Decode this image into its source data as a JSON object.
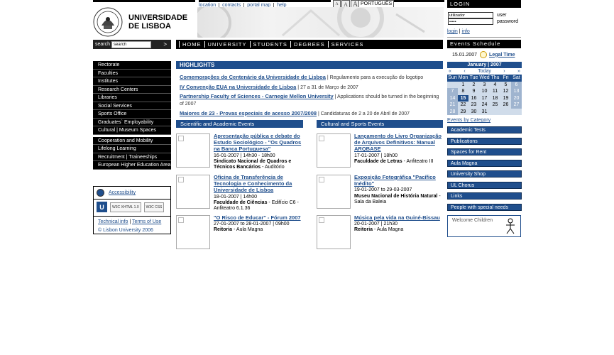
{
  "top": {
    "links": [
      "location",
      "contacts",
      "portal map",
      "help"
    ],
    "font_buttons": [
      "A",
      "A",
      "A"
    ],
    "language": "PORTUGUÊS"
  },
  "logo": {
    "line1": "UNIVERSIDADE",
    "line2": "DE LISBOA"
  },
  "search": {
    "label": "search",
    "value": "search",
    "go": ">"
  },
  "main_nav": [
    "HOME",
    "UNIVERSITY",
    "STUDENTS",
    "DEGREES",
    "SERVICES"
  ],
  "login": {
    "title": "LOGIN",
    "user_value": "utilizador",
    "user_label": "user",
    "password_value": "•••••",
    "password_label": "password",
    "login_link": "login",
    "sep": "|",
    "info_link": "info"
  },
  "events_schedule": {
    "title": "Events Schedule",
    "date": "15.01.2007",
    "legend_time": "Legal Time"
  },
  "calendar": {
    "title": "January | 2007",
    "nav": [
      "«",
      "‹",
      "Today",
      "›",
      "»"
    ],
    "weekdays": [
      "Sun",
      "Mon",
      "Tue",
      "Wed",
      "Thu",
      "Fri",
      "Sat"
    ],
    "weeks": [
      [
        "",
        "1",
        "2",
        "3",
        "4",
        "5",
        "6"
      ],
      [
        "7",
        "8",
        "9",
        "10",
        "11",
        "12",
        "13"
      ],
      [
        "14",
        "15",
        "16",
        "17",
        "18",
        "19",
        "20"
      ],
      [
        "21",
        "22",
        "23",
        "24",
        "25",
        "26",
        "27"
      ],
      [
        "28",
        "29",
        "30",
        "31",
        "",
        "",
        ""
      ]
    ],
    "today": "15",
    "category_link": "Events by Category"
  },
  "right_menu": [
    "Academic Tests",
    "Publications",
    "Spaces for Rent",
    "Aula Magna",
    "University Shop",
    "UL Chorus",
    "Links",
    "People with special needs"
  ],
  "welcome_banner": "Welcome Children",
  "left_menu": {
    "group1": [
      "Rectorate",
      "Faculties",
      "Institutes",
      "Research Centers",
      "Libraries",
      "Social Services",
      "Sports Office",
      "Graduates` Employability",
      "Cultural | Museum Spaces"
    ],
    "group2": [
      "Cooperation and Mobility",
      "Lifelong Learning",
      "Recruitment | Traineeships",
      "European Higher Education Area"
    ]
  },
  "left_box": {
    "accessibility": "Accessibility",
    "badges": [
      "W3C XHTML 1.0",
      "W3C CSS"
    ],
    "technical_info": "Technical info",
    "sep": "|",
    "terms": "Terms of Use",
    "copyright": "© Lisbon University 2006"
  },
  "highlights": {
    "title": "HIGHLIGHTS",
    "items": [
      {
        "link": "Comemorações do Centenário da Universidade de Lisboa",
        "text": " | Regulamento para a execução do logotipo"
      },
      {
        "link": "IV Convenção EUA na Universidade de Lisboa",
        "text": " | 27 a 31 de Março de 2007"
      },
      {
        "link": "Partnership Faculty of Sciences - Carnegie Mellon University",
        "text": " | Applications should be turned in the beginning of 2007"
      },
      {
        "link": "Maiores de 23 - Provas especiais de acesso 2007/2008",
        "text": " | Candidaturas de 2 a 20 de Abril de 2007"
      }
    ]
  },
  "events": {
    "scientific_title": "Scientific and Academic Events",
    "cultural_title": "Cultural and Sports Events",
    "scientific": [
      {
        "title": "Apresentação pública e debate do Estudo Sociológico - \"Os Quadros na Banca Portuguesa\"",
        "meta": "16-01-2007 | 14h30 - 18h00",
        "place_bold": "Sindicato Nacional de Quadros e Técnicos Bancários",
        "place": " - Auditório"
      },
      {
        "title": "Oficina de Transferência de Tecnologia e Conhecimento da Universidade de Lisboa",
        "meta": "18-01-2007 | 14h00",
        "place_bold": "Faculdade de Ciências",
        "place": " - Edifício C6 - Anfiteatro 6.1.36"
      },
      {
        "title": "\"O Risco de Educar\" - Fórum 2007",
        "meta": "27-01-2007 to 28-01-2007 | 09h00",
        "place_bold": "Reitoria",
        "place": " - Aula Magna"
      }
    ],
    "cultural": [
      {
        "title": "Lançamento do Livro Organização de Arquivos Definitivos: Manual ARQBASE",
        "meta": "17-01-2007 | 18h00",
        "place_bold": "Faculdade de Letras",
        "place": " - Anfiteatro III"
      },
      {
        "title": "Exposição Fotográfica \"Pacífico Inédito\"",
        "meta": "19-01-2007 to 29-03-2007",
        "place_bold": "Museu Nacional de História Natural",
        "place": " - Sala da Baleia"
      },
      {
        "title": "Música pela vida na Guiné-Bissau",
        "meta": "20-01-2007 | 21h30",
        "place_bold": "Reitoria",
        "place": " - Aula Magna"
      }
    ]
  }
}
